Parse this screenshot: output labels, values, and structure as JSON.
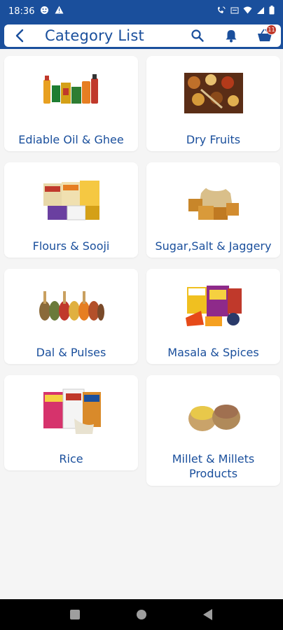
{
  "status_bar": {
    "time": "18:36"
  },
  "header": {
    "title": "Category List",
    "cart_count": "11"
  },
  "categories": [
    {
      "label": "Ediable Oil & Ghee",
      "icon": "oil-ghee-image"
    },
    {
      "label": "Dry Fruits",
      "icon": "dry-fruits-image"
    },
    {
      "label": "Flours & Sooji",
      "icon": "flours-image"
    },
    {
      "label": "Sugar,Salt & Jaggery",
      "icon": "sugar-salt-image"
    },
    {
      "label": "Dal & Pulses",
      "icon": "dal-pulses-image"
    },
    {
      "label": "Masala & Spices",
      "icon": "masala-image"
    },
    {
      "label": "Rice",
      "icon": "rice-image"
    },
    {
      "label": "Millet & Millets Products",
      "icon": "millet-image"
    }
  ],
  "colors": {
    "brand": "#1a4f9c",
    "background": "#f5f5f5",
    "badge": "#c0392b"
  }
}
